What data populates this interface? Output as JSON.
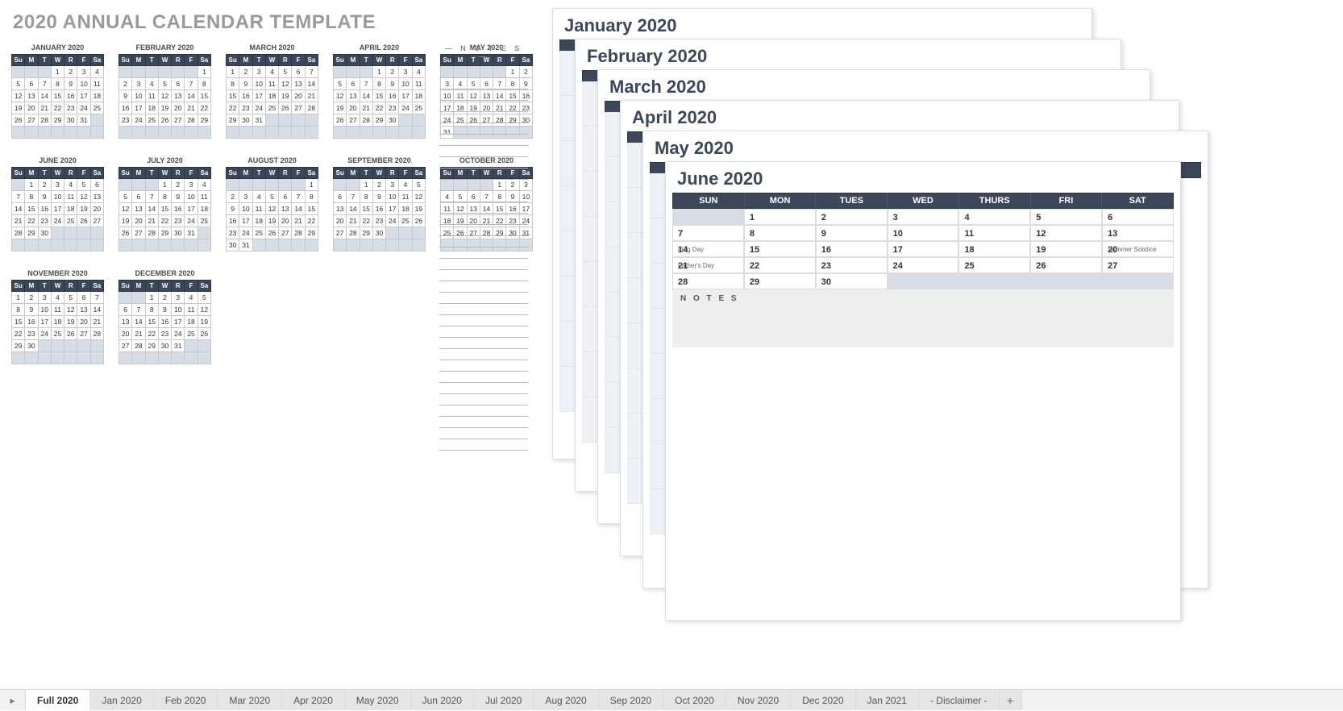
{
  "title": "2020 ANNUAL CALENDAR TEMPLATE",
  "notes_label": "—  N O T E S  —",
  "day_headers_short": [
    "Su",
    "M",
    "T",
    "W",
    "R",
    "F",
    "Sa"
  ],
  "day_headers_long": [
    "SUN",
    "MON",
    "TUES",
    "WED",
    "THURS",
    "FRI",
    "SAT"
  ],
  "mini_months": [
    {
      "name": "JANUARY 2020",
      "start": 3,
      "days": 31
    },
    {
      "name": "FEBRUARY 2020",
      "start": 6,
      "days": 29
    },
    {
      "name": "MARCH 2020",
      "start": 0,
      "days": 31
    },
    {
      "name": "APRIL 2020",
      "start": 3,
      "days": 30
    },
    {
      "name": "MAY 2020",
      "start": 5,
      "days": 31
    },
    {
      "name": "JUNE 2020",
      "start": 1,
      "days": 30
    },
    {
      "name": "JULY 2020",
      "start": 3,
      "days": 31
    },
    {
      "name": "AUGUST 2020",
      "start": 6,
      "days": 31
    },
    {
      "name": "SEPTEMBER 2020",
      "start": 2,
      "days": 30
    },
    {
      "name": "OCTOBER 2020",
      "start": 4,
      "days": 31
    },
    {
      "name": "NOVEMBER 2020",
      "start": 0,
      "days": 30
    },
    {
      "name": "DECEMBER 2020",
      "start": 2,
      "days": 31
    }
  ],
  "stacked_cards": [
    {
      "title": "January 2020"
    },
    {
      "title": "February 2020"
    },
    {
      "title": "March 2020"
    },
    {
      "title": "April 2020"
    },
    {
      "title": "May 2020"
    }
  ],
  "front_card": {
    "title": "June 2020",
    "start": 1,
    "days": 30,
    "events": {
      "14": "Flag Day",
      "20": "Summer Solstice",
      "21": "Father's Day"
    },
    "notes_label": "N O T E S"
  },
  "tabs": [
    "Full 2020",
    "Jan 2020",
    "Feb 2020",
    "Mar 2020",
    "Apr 2020",
    "May 2020",
    "Jun 2020",
    "Jul 2020",
    "Aug 2020",
    "Sep 2020",
    "Oct 2020",
    "Nov 2020",
    "Dec 2020",
    "Jan 2021",
    "- Disclaimer -"
  ],
  "active_tab": 0
}
